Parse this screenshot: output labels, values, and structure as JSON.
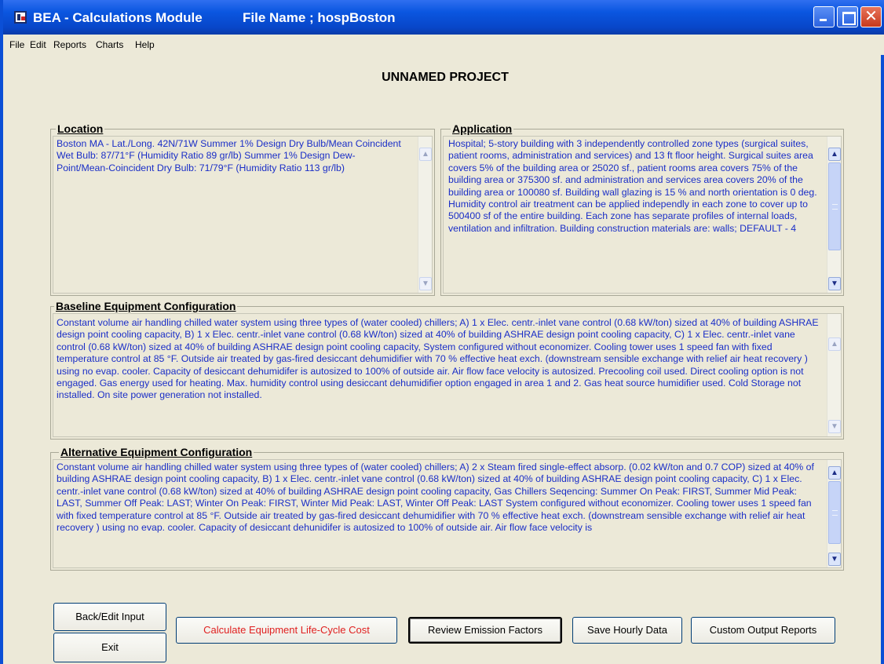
{
  "titlebar": {
    "app_title": "BEA - Calculations Module",
    "file_name": "File Name ; hospBoston"
  },
  "menu": [
    "File",
    "Edit",
    "Reports",
    "Charts",
    "Help"
  ],
  "project_title": "UNNAMED PROJECT",
  "location": {
    "label": "Location",
    "text": "Boston MA - Lat./Long. 42N/71W   Summer 1% Design Dry Bulb/Mean Coincident Wet Bulb: 87/71°F (Humidity Ratio 89 gr/lb) Summer 1% Design Dew-Point/Mean-Coincident Dry Bulb: 71/79°F (Humidity Ratio 113 gr/lb)"
  },
  "application": {
    "label": "Application",
    "text": "Hospital; 5-story building with 3 independently controlled zone types (surgical suites, patient rooms, administration and services) and 13 ft floor height.  Surgical suites area covers 5% of the building area or 25020 sf., patient rooms area covers 75% of the building area or 375300 sf. and administration and services area covers 20% of the building area or 100080 sf. Building wall glazing is 15 % and north orientation is 0 deg.  Humidity control air treatment can be applied independly in each zone to cover up to 500400 sf of the entire building. Each zone has separate profiles of internal loads, ventilation and infiltration. Building construction materials are: walls; DEFAULT - 4"
  },
  "baseline": {
    "label": "Baseline Equipment Configuration",
    "text": "Constant volume air handling chilled water system using three types of (water cooled) chillers; A) 1 x Elec. centr.-inlet vane control (0.68 kW/ton) sized at 40% of building ASHRAE design point cooling capacity,   B) 1 x Elec. centr.-inlet vane control (0.68 kW/ton) sized at 40% of building ASHRAE design point cooling capacity,   C) 1 x Elec. centr.-inlet vane control (0.68 kW/ton) sized at 40% of building ASHRAE design point cooling capacity,   System configured without economizer.  Cooling tower uses 1 speed fan with fixed temperature control at 85 °F.  Outside air treated by gas-fired desiccant dehumidifier with 70 % effective heat exch. (downstream sensible exchange with relief air heat recovery ) using no evap. cooler.  Capacity of desiccant dehumidifer is autosized to 100% of outside air. Air flow face velocity is autosized. Precooling coil used. Direct cooling option is not engaged.  Gas energy used for heating.  Max. humidity control using desiccant dehumidifier option engaged in area 1 and 2. Gas heat source humidifier used.  Cold Storage not installed.  On site power generation not installed."
  },
  "alternative": {
    "label": "Alternative Equipment Configuration",
    "text": "Constant volume air handling chilled water system using three types of (water cooled) chillers; A) 2 x Steam fired single-effect absorp. (0.02 kW/ton and 0.7 COP) sized at 40% of building ASHRAE design point cooling capacity,   B) 1 x Elec. centr.-inlet vane control (0.68 kW/ton) sized at 40% of building ASHRAE design point cooling capacity,   C) 1 x Elec. centr.-inlet vane control (0.68 kW/ton) sized at 40% of building ASHRAE design point cooling capacity,    Gas Chillers Seqencing: Summer On Peak: FIRST, Summer Mid Peak: LAST, Summer Off Peak: LAST;  Winter On Peak: FIRST, Winter Mid Peak: LAST, Winter Off Peak: LAST    System configured without economizer.  Cooling tower uses 1 speed fan with fixed temperature control at 85 °F.  Outside air treated by gas-fired desiccant dehumidifier with 70 % effective heat exch. (downstream sensible exchange with relief air heat recovery ) using no evap. cooler.  Capacity of desiccant dehunidifer is autosized to 100% of outside air. Air flow face velocity is"
  },
  "buttons": {
    "back_edit": "Back/Edit Input",
    "exit": "Exit",
    "calculate": "Calculate Equipment Life-Cycle Cost",
    "review": "Review Emission Factors",
    "save_hourly": "Save Hourly Data",
    "custom_reports": "Custom Output Reports"
  },
  "colors": {
    "title_bar": "#0a56e0",
    "field_text": "#1a2ec7",
    "calculate_text": "#e02020",
    "background": "#ece9d8"
  }
}
